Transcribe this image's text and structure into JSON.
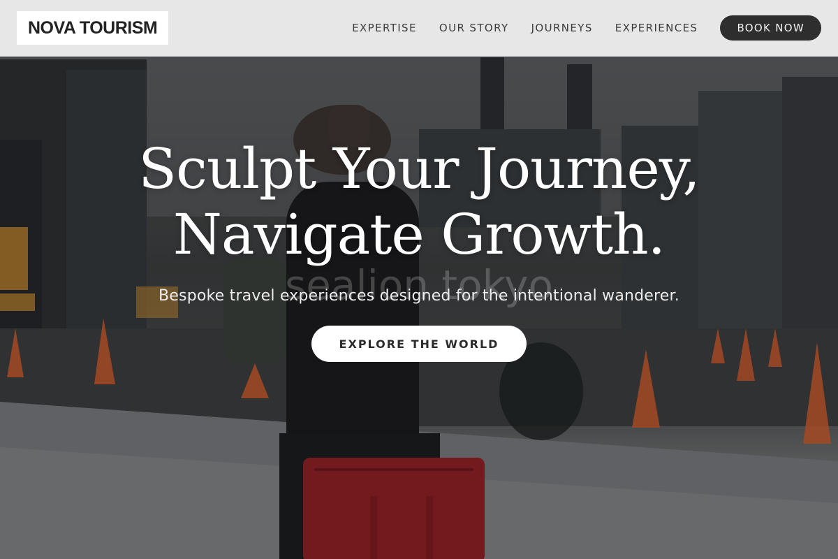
{
  "brand": {
    "logo_text": "NOVA TOURISM"
  },
  "nav": {
    "links": [
      {
        "label": "EXPERTISE"
      },
      {
        "label": "OUR STORY"
      },
      {
        "label": "JOURNEYS"
      },
      {
        "label": "EXPERIENCES"
      }
    ],
    "book_label": "BOOK NOW"
  },
  "hero": {
    "headline": "Sculpt Your Journey, Navigate Growth.",
    "subtitle": "Bespoke travel experiences designed for the intentional wanderer.",
    "cta_label": "EXPLORE THE WORLD",
    "watermark": "sealion tokyo"
  },
  "colors": {
    "nav_background": "#f0f0f0",
    "book_button": "#2e2e2e",
    "cta_background": "#ffffff",
    "headline_text": "#ffffff",
    "suitcase_red": "#8c2025",
    "traffic_cone": "#d9532b"
  }
}
